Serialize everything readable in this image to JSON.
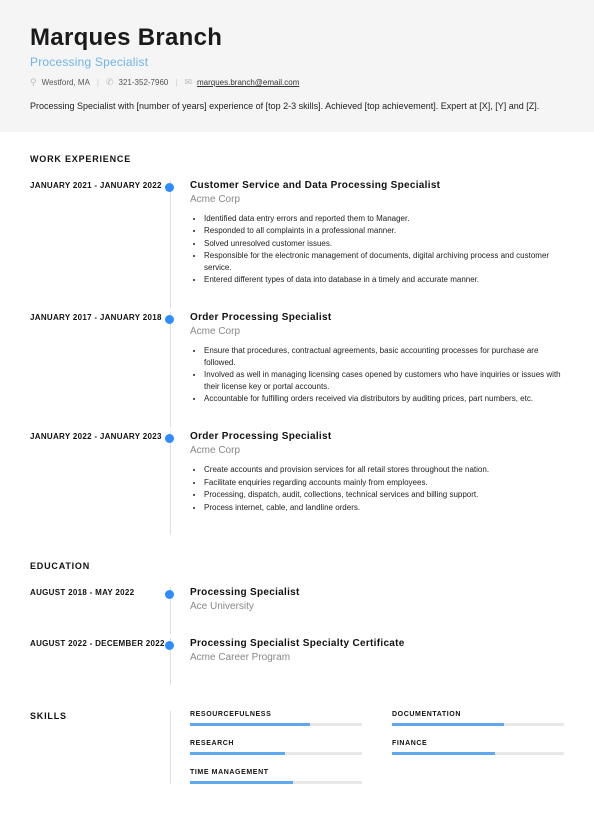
{
  "header": {
    "name": "Marques Branch",
    "title": "Processing Specialist",
    "location": "Westford, MA",
    "phone": "321-352-7960",
    "email": "marques.branch@email.com",
    "summary": "Processing Specialist with [number of years] experience of [top 2-3 skills]. Achieved [top achievement]. Expert at [X], [Y] and [Z]."
  },
  "sections": {
    "work": "WORK EXPERIENCE",
    "edu": "EDUCATION",
    "skills": "SKILLS"
  },
  "work": [
    {
      "dates": "JANUARY 2021 - JANUARY 2022",
      "title": "Customer Service and Data Processing Specialist",
      "company": "Acme Corp",
      "bullets": [
        "Identified data entry errors and reported them to Manager.",
        "Responded to all complaints in a professional manner.",
        "Solved unresolved customer issues.",
        "Responsible for the electronic management of documents, digital archiving process and customer service.",
        "Entered different types of data into database in a timely and accurate manner."
      ]
    },
    {
      "dates": "JANUARY 2017 - JANUARY 2018",
      "title": "Order Processing Specialist",
      "company": "Acme Corp",
      "bullets": [
        "Ensure that procedures, contractual agreements, basic accounting processes for purchase are followed.",
        "Involved as well in managing licensing cases opened by customers who have inquiries or issues with their license key or portal accounts.",
        "Accountable for fulfilling orders received via distributors by auditing prices, part numbers, etc."
      ]
    },
    {
      "dates": "JANUARY 2022 - JANUARY 2023",
      "title": "Order Processing Specialist",
      "company": "Acme Corp",
      "bullets": [
        "Create accounts and provision services for all retail stores throughout the nation.",
        "Facilitate enquiries regarding accounts mainly from employees.",
        "Processing, dispatch, audit, collections, technical services and billing support.",
        "Process internet, cable, and landline orders."
      ]
    }
  ],
  "edu": [
    {
      "dates": "AUGUST 2018 - MAY 2022",
      "title": "Processing Specialist",
      "school": "Ace University"
    },
    {
      "dates": "AUGUST 2022 - DECEMBER 2022",
      "title": "Processing Specialist Specialty Certificate",
      "school": "Acme Career Program"
    }
  ],
  "skills": [
    {
      "name": "RESOURCEFULNESS",
      "pct": 70
    },
    {
      "name": "DOCUMENTATION",
      "pct": 65
    },
    {
      "name": "RESEARCH",
      "pct": 55
    },
    {
      "name": "FINANCE",
      "pct": 60
    },
    {
      "name": "TIME MANAGEMENT",
      "pct": 60
    }
  ]
}
